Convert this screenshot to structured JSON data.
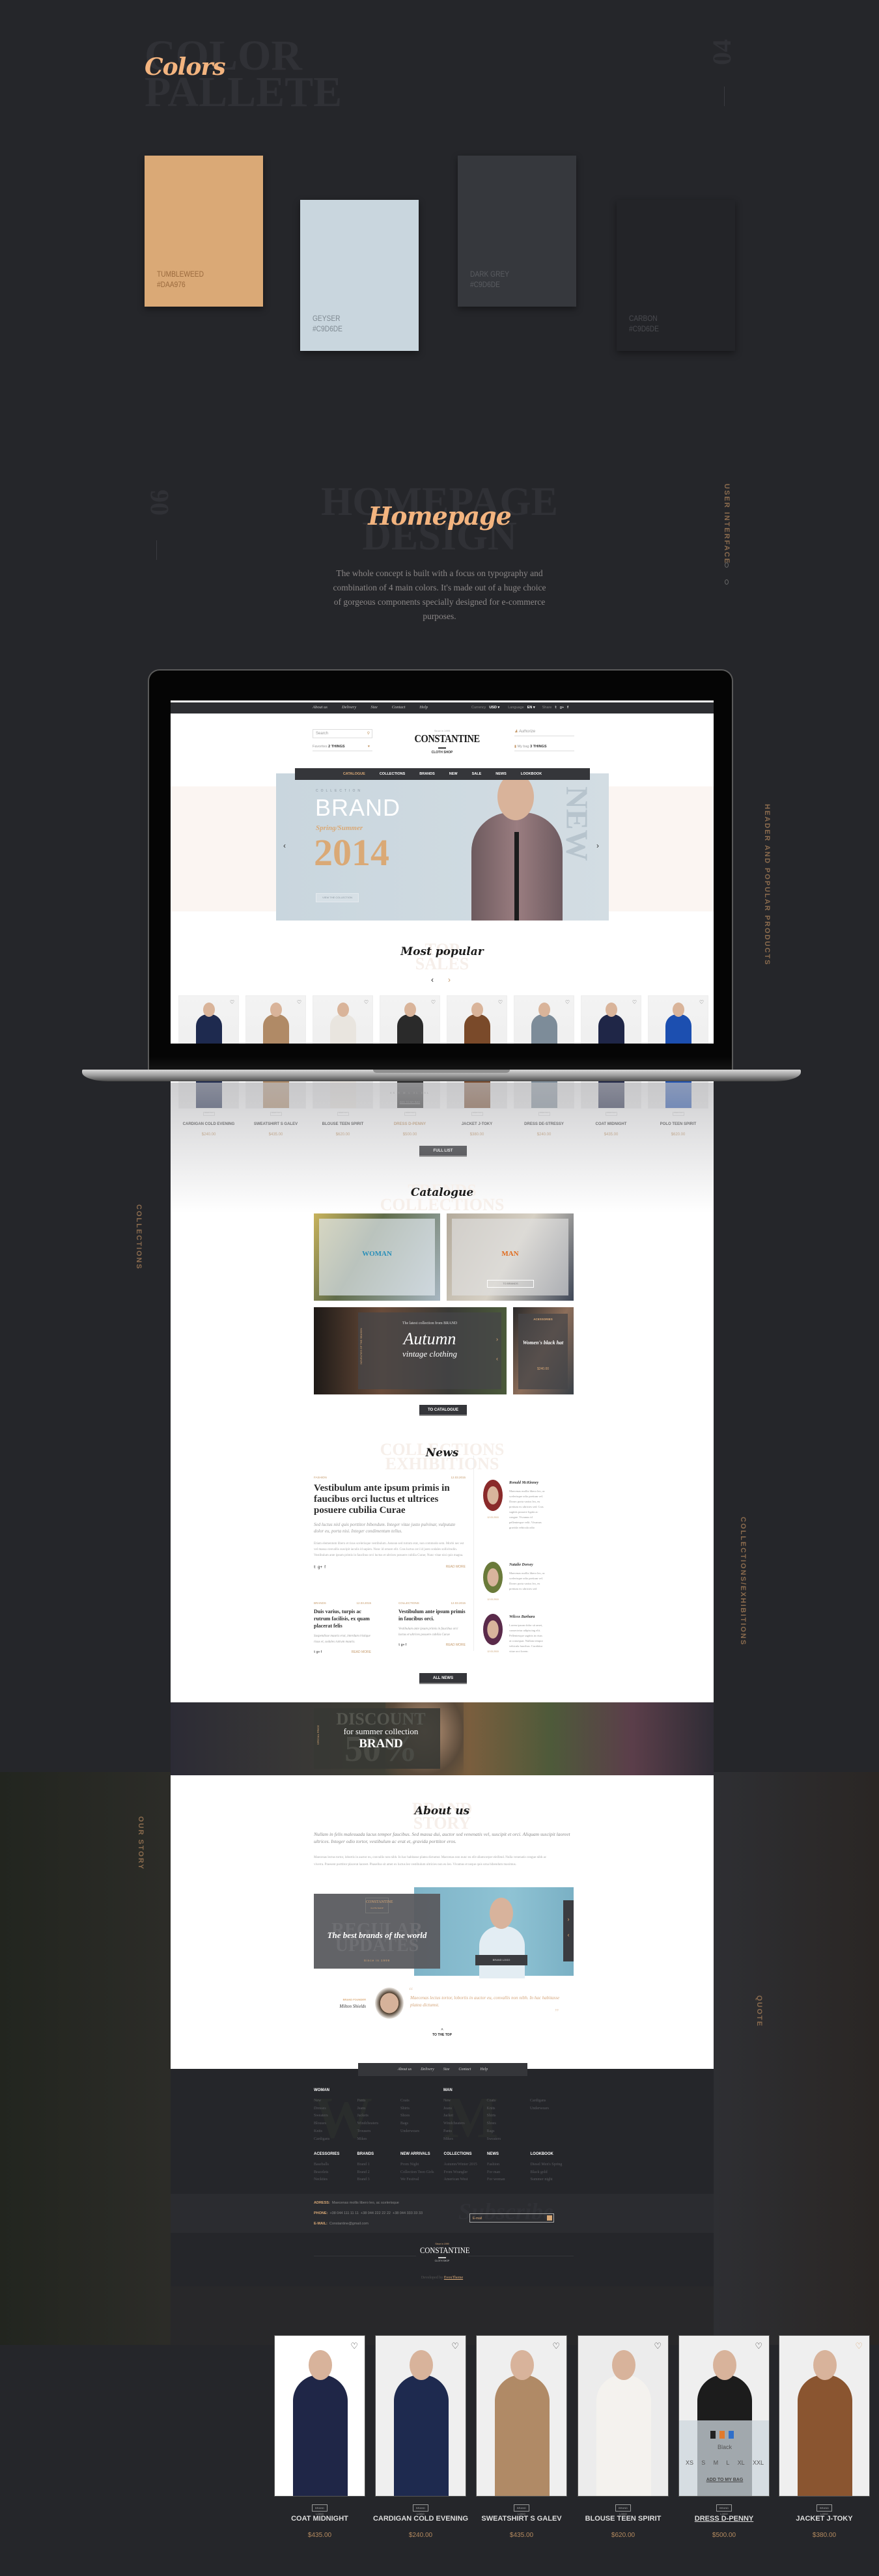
{
  "colors_section": {
    "ghost_title": "COLOR\nPALLETE",
    "title": "Colors",
    "number": "04",
    "swatches": [
      {
        "name": "TUMBLEWEED",
        "hex": "#DAA976",
        "fill": "#daa976",
        "text_color": "#9a6a3e"
      },
      {
        "name": "GEYSER",
        "hex": "#C9D6DE",
        "fill": "#c9d6de",
        "text_color": "#7f8a92"
      },
      {
        "name": "DARK GREY",
        "hex": "#C9D6DE",
        "fill": "#36383d",
        "text_color": "#5a5c61"
      },
      {
        "name": "CARBON",
        "hex": "#C9D6DE",
        "fill": "#232428",
        "text_color": "#4a4b50"
      }
    ]
  },
  "homepage_section": {
    "number": "06",
    "ghost_title": "HOMEPAGE\nDESIGN",
    "title": "Homepage",
    "description": "The whole concept is built with a focus on typography and combination of 4 main colors. It's made out of a huge choice of gorgeous components specially designed for e-commerce purposes.",
    "side_label": "USER INTERFACE"
  },
  "side_labels": {
    "header": "HEADER AND POPULAR PRODUCTS",
    "collections": "COLLECTIONS",
    "exhibitions": "COLLECTIONS/EXHIBITIONS",
    "story": "OUR STORY",
    "quote": "QUOTE"
  },
  "site": {
    "topbar": {
      "links": [
        "About us",
        "Delivery",
        "Size",
        "Contact",
        "Help"
      ],
      "currency_label": "Currency",
      "currency": "USD ▾",
      "language_label": "Language",
      "language": "EN ▾",
      "share_label": "Share"
    },
    "header": {
      "search_placeholder": "Search",
      "favorites_label": "Favorites",
      "favorites_count": "2 THINGS",
      "logo_since": "Since in 1999",
      "logo": "CONSTANTINE",
      "logo_sub": "CLOTH SHOP",
      "authorize": "Authorize",
      "bag_label": "My bag",
      "bag_count": "3 THINGS"
    },
    "nav": [
      "CATALOGUE",
      "COLLECTIONS",
      "BRANDS",
      "NEW",
      "SALE",
      "NEWS",
      "LOOKBOOK"
    ],
    "hero": {
      "kicker": "COLLECTION",
      "brand": "BRAND",
      "season": "Spring/Summer",
      "year": "2014",
      "button": "VIEW THE COLLECTION",
      "ghost": "NEW"
    },
    "popular": {
      "title": "Most popular",
      "ghost": "TOP\nSALES",
      "brand_logo": "BRAND LOGO",
      "products": [
        {
          "name": "CARDIGAN COLD EVENING",
          "price": "$240.00",
          "color": "#1e2a4f"
        },
        {
          "name": "SWEATSHIRT S GALEV",
          "price": "$435.00",
          "color": "#b08a66"
        },
        {
          "name": "BLOUSE TEEN SPIRIT",
          "price": "$620.00",
          "color": "#e9e5df"
        },
        {
          "name": "DRESS D-PENNY",
          "price": "$500.00",
          "color": "#2a2a2a"
        },
        {
          "name": "JACKET J-TOKY",
          "price": "$380.00",
          "color": "#7a4a2a"
        },
        {
          "name": "DRESS DE-STRESSY",
          "price": "$240.00",
          "color": "#7d8c99"
        },
        {
          "name": "COAT MIDNIGHT",
          "price": "$435.00",
          "color": "#1f2647"
        },
        {
          "name": "POLO TEEN SPIRIT",
          "price": "$620.00",
          "color": "#1c4fb0"
        }
      ],
      "hover_sizes": "XS S M L XL XXL",
      "hover_add": "ADD TO MY BAG",
      "full_list": "FULL LIST"
    },
    "catalogue": {
      "title": "Catalogue",
      "ghost": "TRENDS\nCOLLECTIONS",
      "woman": "WOMAN",
      "woman_color": "#2a8fb8",
      "man": "MAN",
      "man_color": "#e06a1c",
      "man_button": "TO BRANDS",
      "autumn_kicker": "The latest collection from BRAND",
      "autumn_title": "Autumn",
      "autumn_sub": "vintage clothing",
      "autumn_side": "NOVELTIES OF THE SEASON",
      "hat_tag": "ACESSORIES",
      "hat_title": "Women's black hat",
      "hat_price": "$240.00",
      "button": "TO CATALOGUE"
    },
    "news": {
      "title": "News",
      "ghost": "COLLECTIONS\nEXHIBITIONS",
      "main": {
        "category": "FASHION",
        "date": "12.03.2015",
        "headline": "Vestibulum ante ipsum primis in faucibus orci luctus et ultrices posuere cubilia Curae",
        "lead": "Sed luctus nisl quis porttitor bibendum. Integer vitae justo pulvinar, vulputate dolor eu, porta nisi. Integer condimentum tellus.",
        "body": "Etiam elementum libero et risus scelerisque vestibulum. Aenean sed rutrum erat, non commodo sem. Morbi nec est vel massa convallis suscipit iaculis id sapien. Nunc id ornare elit. Cras luctus orci id justo sodales sollicitudin. Vestibulum ante ipsum primis in faucibus orci luctus et ultrices posuere cubilia Curae; Nunc vitae nisi quis magna.",
        "read_more": "READ MORE"
      },
      "small": [
        {
          "category": "BRANDS",
          "date": "12.03.2015",
          "headline": "Duis varius, turpis ac rutrum facilisis, ex quam placerat felis",
          "lead": "Suspendisse mauris erat, interdum tristique risus et, sodales rutrum mauris.",
          "read_more": "READ MORE"
        },
        {
          "category": "COLLECTIONS",
          "date": "12.03.2015",
          "headline": "Vestibulum ante ipsum primis in faucibus orci.",
          "lead": "Vestibulum ante ipsum primis in faucibus orci luctus et ultrices posuere cubilia Curae",
          "read_more": "READ MORE"
        }
      ],
      "comments": [
        {
          "name": "Ronald McKinney",
          "date": "12.03.2015",
          "text": "Maecenas mollis libero leo, ac scelerisque odio pretium vel. Donec porta varius leo, eu pretium ex ultricies sed. Cras sagittis posuere ligula ac congue. Vivamus id pellentesque velit. Vivamus gravida vehicula odio",
          "avatar": "#8a2a2a"
        },
        {
          "name": "Natalie Dorsey",
          "date": "12.03.2015",
          "text": "Maecenas mollis libero leo, ac scelerisque odio pretium vel. Donec porta varius leo, eu pretium ex ultricies sed",
          "avatar": "#6a7a3a"
        },
        {
          "name": "Wilcox Barbara",
          "date": "12.03.2015",
          "text": "Lorem ipsum dolor sit amet, consectetur adipiscing elit. Pellentesque sagittis in risus at consequat. Nullam tempor vehicula faucibus. Curabitur vitae orci lorem.",
          "avatar": "#5a2a4a"
        }
      ],
      "button": "ALL NEWS"
    },
    "discount": {
      "ghost_top": "DISCOUNT",
      "ghost_bottom": "50%",
      "line": "for summer collection",
      "brand": "BRAND",
      "side": "SPECIAL PRICE"
    },
    "about": {
      "title": "About us",
      "ghost": "BRAND\nSTORY",
      "lead": "Nullam in felis malesuada lacus tempor faucibus. Sed massa dui, auctor sed venenatis vel, suscipit et orci. Aliquam suscipit laoreet ultrices. Integer odio tortor, vestibulum ac erat et, gravida porttitor eros.",
      "body": "Maecenas lectus tortor, lobortis in auctor eu, convallis non nibh. In hac habitasse platea dictumst. Maecenas non nunc eu elit ullamcorper eleifend. Nulla venenatis congue nibh ac viverra. Praesent porttitor placerat laoreet. Phasellus sit amet ex luctus leo vestibulum ultricies non eu leo. Vivamus et neque quis urna bibendum maximus.",
      "banner_logo": "CONSTANTINE",
      "banner_logo_sub": "CLOTH SHOP",
      "banner_ghost": "REGULAR\nUPDATES",
      "banner_title": "The best brands of the world",
      "banner_since": "Since in 1999",
      "banner_button": "BRAND LOGO",
      "founder_label": "BRAND FOUNDER",
      "founder_name": "Milton Shields",
      "quote": "Maecenas lectus tortor, lobortis in auctor eu, convallis non nibh. In hac habitasse platea dictumst.",
      "to_top": "TO THE TOP"
    },
    "footer": {
      "nav": [
        "About us",
        "Delivery",
        "Size",
        "Contact",
        "Help"
      ],
      "groups_top": [
        {
          "title": "WOMAN",
          "cols": [
            [
              "New",
              "Dresses",
              "Sweaters",
              "Blouses",
              "Knits",
              "Cardigans"
            ],
            [
              "Pants",
              "Jeans",
              "Jackets",
              "Windcheaters",
              "Trousers",
              "Mikes"
            ],
            [
              "Coats",
              "Shirts",
              "Shoes",
              "Bags",
              "Underwears"
            ]
          ]
        },
        {
          "title": "MAN",
          "cols": [
            [
              "New",
              "Jeans",
              "Jacket",
              "Windcheaters",
              "Pants",
              "Mikes"
            ],
            [
              "Coats",
              "Knits",
              "Shirts",
              "Shoes",
              "Bags",
              "Sweaters"
            ],
            [
              "Cardigans",
              "Underwears"
            ]
          ]
        }
      ],
      "groups_bottom": [
        {
          "title": "ACESSORIES",
          "items": [
            "Baseballs",
            "Bracelets",
            "Neckties"
          ]
        },
        {
          "title": "BRANDS",
          "items": [
            "Brand 1",
            "Brand 2",
            "Brand 3"
          ]
        },
        {
          "title": "NEW ARRIVALS",
          "items": [
            "Prom Night",
            "Collection Teen Girls",
            "We Festival"
          ]
        },
        {
          "title": "COLLECTIONS",
          "items": [
            "Autumn/Winter 2015",
            "From Wrangler",
            "American West"
          ]
        },
        {
          "title": "NEWS",
          "items": [
            "Fashion",
            "For man",
            "For woman"
          ]
        },
        {
          "title": "LOOKBOOK",
          "items": [
            "Diesel Men's Spring",
            "Black gold",
            "Summer night"
          ]
        }
      ],
      "address_label": "ADRESS:",
      "address": "Maecenas mollis libero leo, ac scelerisque",
      "phone_label": "PHONE:",
      "phones": [
        "+38 044 111 11 11",
        "+38 044 222 22 22",
        "+38 044 333 33 33"
      ],
      "email_label": "E-MAIL:",
      "email": "Constantine@gmail.com",
      "subscribe_ghost": "Subscribe",
      "email_placeholder": "E-mail",
      "logo_since": "Since in 1999",
      "logo": "CONSTANTINE",
      "logo_sub": "CLOTH SHOP",
      "developed_by": "Developed by",
      "developer": "EvoxTheme"
    }
  },
  "showcase": {
    "brand_logo": "BRAND LOGO",
    "products": [
      {
        "name": "COAT MIDNIGHT",
        "price": "$435.00",
        "color": "#1f2647",
        "bg": "#ffffff"
      },
      {
        "name": "CARDIGAN COLD EVENING",
        "price": "$240.00",
        "color": "#1e2a4f",
        "bg": "#efefef"
      },
      {
        "name": "SWEATSHIRT S GALEV",
        "price": "$435.00",
        "color": "#b08a66",
        "bg": "#efefef"
      },
      {
        "name": "BLOUSE TEEN SPIRIT",
        "price": "$620.00",
        "color": "#f4f2ee",
        "bg": "#ececec"
      },
      {
        "name": "DRESS D-PENNY",
        "price": "$500.00",
        "color": "#1c1c1c",
        "bg": "#efefef"
      },
      {
        "name": "JACKET J-TOKY",
        "price": "$380.00",
        "color": "#8a5530",
        "bg": "#efefef"
      }
    ],
    "hover": {
      "color_label": "Black",
      "swatches": [
        "#222222",
        "#e07a2c",
        "#2f6fc9"
      ],
      "sizes": [
        "XS",
        "S",
        "M",
        "L",
        "XL",
        "XXL"
      ],
      "add": "ADD TO MY BAG"
    }
  }
}
